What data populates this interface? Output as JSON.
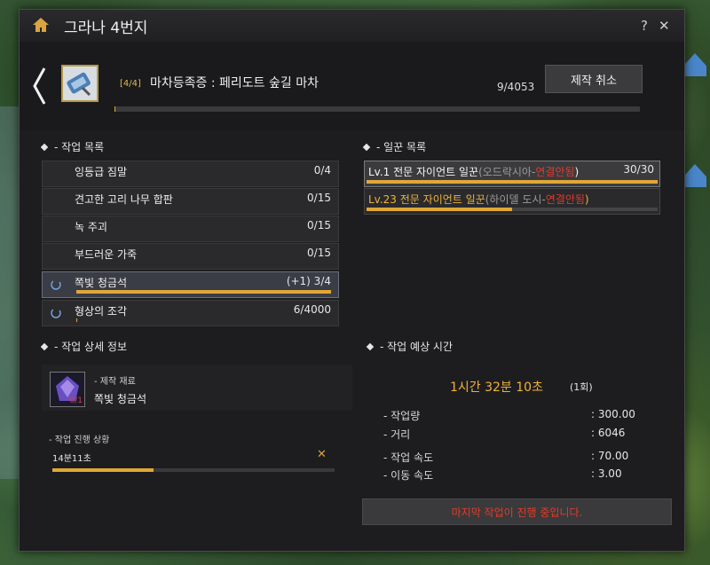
{
  "window": {
    "title": "그라나 4번지"
  },
  "title_buttons": {
    "help": "?",
    "close": "✕"
  },
  "header": {
    "order_count": "[4/4]",
    "order_name": "마차등족증 : 페리도트 숲길 마차",
    "progress": "9/4053",
    "progress_ratio": 0.0022,
    "cancel_label": "제작 취소"
  },
  "work_list": {
    "title": "- 작업 목록",
    "items": [
      {
        "name": "잉등급 짐말",
        "count": "0/4",
        "ratio": 0
      },
      {
        "name": "견고한 고리 나무 합판",
        "count": "0/15",
        "ratio": 0
      },
      {
        "name": "녹 주괴",
        "count": "0/15",
        "ratio": 0
      },
      {
        "name": "부드러운 가죽",
        "count": "0/15",
        "ratio": 0
      },
      {
        "name": "쪽빛 청금석",
        "count": "(+1)  3/4",
        "ratio": 1.0
      },
      {
        "name": "형상의 조각",
        "count": "6/4000",
        "ratio": 0.0015
      }
    ]
  },
  "worker_list": {
    "title": "- 일꾼 목록",
    "workers": [
      {
        "prefix": "Lv.1 전문 자이언트 일꾼",
        "location": "(오드락시아-",
        "status": "연결안됨",
        "close_paren": ")",
        "count": "30/30",
        "ratio": 1.0
      },
      {
        "prefix": "Lv.23 전문 자이언트 일꾼",
        "location": "(하이델 도시-",
        "status": "연결안됨",
        "close_paren": ")",
        "count": "",
        "ratio": 0.5
      }
    ]
  },
  "detail": {
    "title": "- 작업 상세 정보",
    "material_label": "- 제작 재료",
    "material_name": "쪽빛 청금석",
    "material_qty": "0/1",
    "progress_label": "- 작업 진행 상황",
    "progress_time": "14분11초",
    "progress_close": "✕",
    "progress_ratio": 0.36
  },
  "estimate": {
    "title": "- 작업 예상 시간",
    "time": "1시간 32분 10초",
    "times": "(1회)",
    "stats": [
      {
        "label": "- 작업량",
        "value": ": 300.00"
      },
      {
        "label": "- 거리",
        "value": ": 6046"
      },
      {
        "label": "- 작업 속도",
        "value": ": 70.00"
      },
      {
        "label": "- 이동 속도",
        "value": ": 3.00"
      }
    ]
  },
  "status_bar": {
    "text": "마지막 작업이 진행 중입니다."
  },
  "colors": {
    "accent": "#e0a838",
    "warning": "#e23a2a",
    "panel": "#1d1d1f"
  },
  "icons": [
    "home-icon",
    "back-chevron-icon",
    "wagon-icon",
    "spinner-icon",
    "gem-icon",
    "help-icon",
    "close-icon"
  ]
}
